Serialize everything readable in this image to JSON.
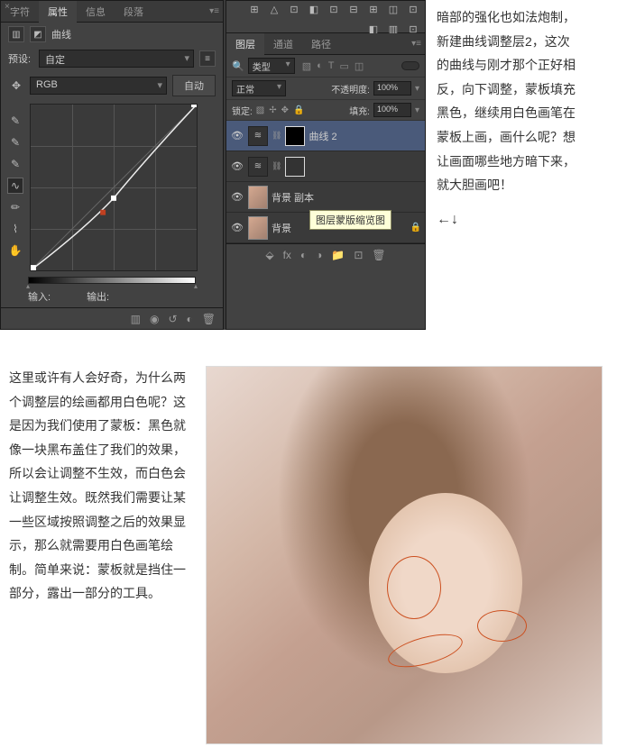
{
  "curves_panel": {
    "tabs": {
      "char": "字符",
      "properties": "属性",
      "info": "信息",
      "paragraph": "段落"
    },
    "title": "曲线",
    "preset_label": "预设:",
    "preset_value": "自定",
    "channel_value": "RGB",
    "auto_btn": "自动",
    "input_label": "输入:",
    "output_label": "输出:"
  },
  "layers_panel": {
    "tabs": {
      "layers": "图层",
      "channels": "通道",
      "paths": "路径"
    },
    "type_label": "类型",
    "blend_mode": "正常",
    "opacity_label": "不透明度:",
    "opacity_value": "100%",
    "lock_label": "锁定:",
    "fill_label": "填充:",
    "fill_value": "100%",
    "layers": [
      {
        "name": "曲线 2",
        "type": "adj",
        "selected": true
      },
      {
        "name": "",
        "type": "adj",
        "selected": false
      },
      {
        "name": "背景 副本",
        "type": "img",
        "selected": false
      },
      {
        "name": "背景",
        "type": "img",
        "locked": true,
        "selected": false
      }
    ],
    "tooltip": "图层蒙版缩览图"
  },
  "right_text": "暗部的强化也如法炮制，新建曲线调整层2，这次的曲线与刚才那个正好相反，向下调整，蒙板填充黑色，继续用白色画笔在蒙板上画，画什么呢？想让画面哪些地方暗下来，就大胆画吧！",
  "nav_arrows": "←↓",
  "left_text": "这里或许有人会好奇，为什么两个调整层的绘画都用白色呢？这是因为我们使用了蒙板：黑色就像一块黑布盖住了我们的效果，所以会让调整不生效，而白色会让调整生效。既然我们需要让某一些区域按照调整之后的效果显示，那么就需要用白色画笔绘制。简单来说：蒙板就是挡住一部分，露出一部分的工具。",
  "chart_data": {
    "type": "line",
    "title": "曲线",
    "xlabel": "输入",
    "ylabel": "输出",
    "xlim": [
      0,
      255
    ],
    "ylim": [
      0,
      255
    ],
    "points": [
      {
        "x": 0,
        "y": 0
      },
      {
        "x": 110,
        "y": 90
      },
      {
        "x": 128,
        "y": 112
      },
      {
        "x": 255,
        "y": 255
      }
    ]
  }
}
